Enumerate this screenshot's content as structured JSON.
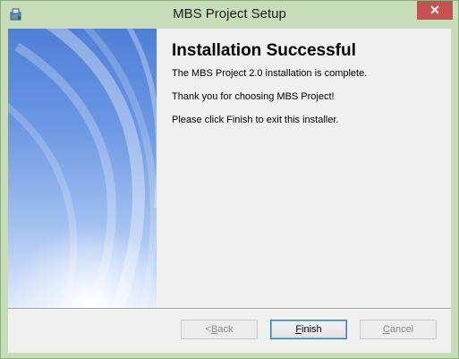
{
  "window": {
    "title": "MBS Project Setup",
    "close_glyph": "✕",
    "app_icon": "setup-package-icon"
  },
  "content": {
    "heading": "Installation Successful",
    "line1": "The MBS Project 2.0 installation is complete.",
    "line2": "Thank you for choosing MBS Project!",
    "line3": "Please click Finish to exit this installer."
  },
  "buttons": {
    "back": {
      "mnemonic": "",
      "label": "< ",
      "accel": "B",
      "rest": "ack"
    },
    "finish": {
      "accel": "F",
      "rest": "inish"
    },
    "cancel": {
      "accel": "C",
      "rest": "ancel"
    }
  },
  "colors": {
    "frame": "#c7dcb8",
    "close": "#c75050",
    "panel_top": "#4f7fd6",
    "panel_bottom": "#dfe9fb"
  }
}
